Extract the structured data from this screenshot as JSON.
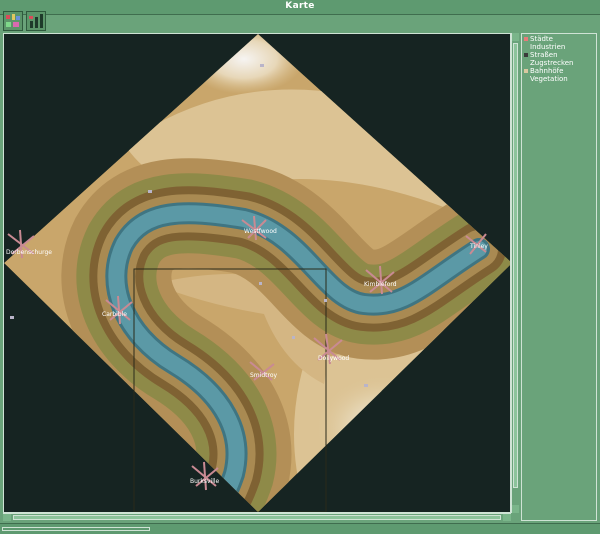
{
  "window": {
    "title": "Karte"
  },
  "toolbar": {
    "legend_button_icon": "city-legend-icon",
    "graph_button_icon": "bar-chart-icon"
  },
  "legend": {
    "items": [
      {
        "label": "Städte",
        "color": "#e87a7a"
      },
      {
        "label": "Industrien",
        "color": ""
      },
      {
        "label": "Straßen",
        "color": "#3a3a3a"
      },
      {
        "label": "Zugstrecken",
        "color": ""
      },
      {
        "label": "Bahnhöfe",
        "color": "#d9c8a0"
      },
      {
        "label": "Vegetation",
        "color": ""
      }
    ]
  },
  "map": {
    "colors": {
      "background": "#162422",
      "river": "#5b99a6",
      "river_edge": "#3f7582",
      "bank_dark": "#7f6233",
      "bank_mid": "#8e8a48",
      "land_low": "#b38f57",
      "land_mid": "#c9a66b",
      "land_high": "#dcc394",
      "peak": "#f0eeea",
      "city": "#c98a93"
    },
    "cities": [
      {
        "name": "Westfwood"
      },
      {
        "name": "Tinley"
      },
      {
        "name": "Kimbleford"
      },
      {
        "name": "Dorbenschurge"
      },
      {
        "name": "Carbible"
      },
      {
        "name": "Dollywood"
      },
      {
        "name": "Smidtroy"
      },
      {
        "name": "Burksville"
      }
    ]
  }
}
